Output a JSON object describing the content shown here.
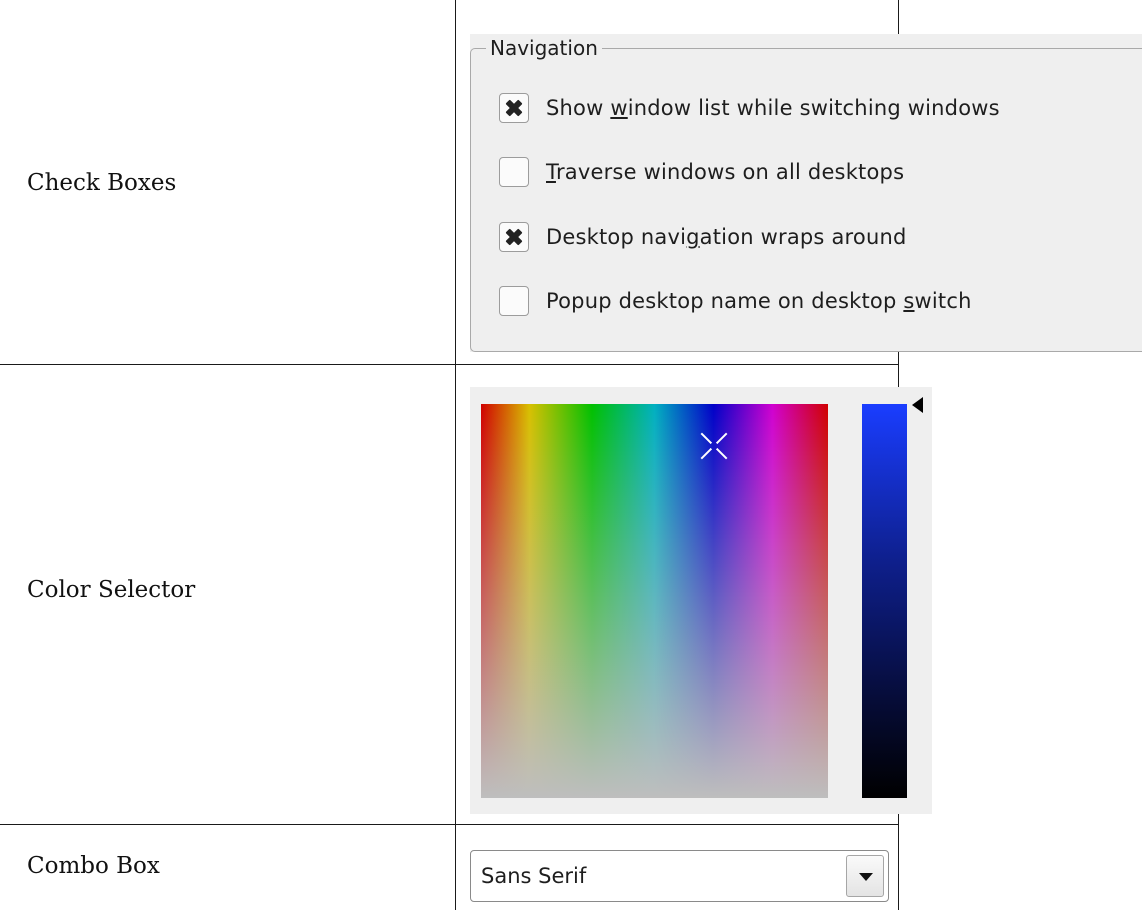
{
  "rows": [
    {
      "label": "Check Boxes"
    },
    {
      "label": "Color Selector"
    },
    {
      "label": "Combo Box"
    }
  ],
  "navigation_group": {
    "title": "Navigation",
    "checkboxes": [
      {
        "pre": "Show ",
        "mnemonic": "w",
        "post": "indow list while switching windows",
        "checked": true
      },
      {
        "pre": "",
        "mnemonic": "T",
        "post": "raverse windows on all desktops",
        "checked": false
      },
      {
        "pre": "Desktop navi",
        "mnemonic": "g",
        "post": "ation wraps around",
        "checked": true
      },
      {
        "pre": "Popup desktop name on desktop ",
        "mnemonic": "s",
        "post": "witch",
        "checked": false
      }
    ]
  },
  "color_selector": {
    "value_color_top": "#1a3dff",
    "value_color_bottom": "#000000"
  },
  "combo_box": {
    "value": "Sans Serif"
  }
}
